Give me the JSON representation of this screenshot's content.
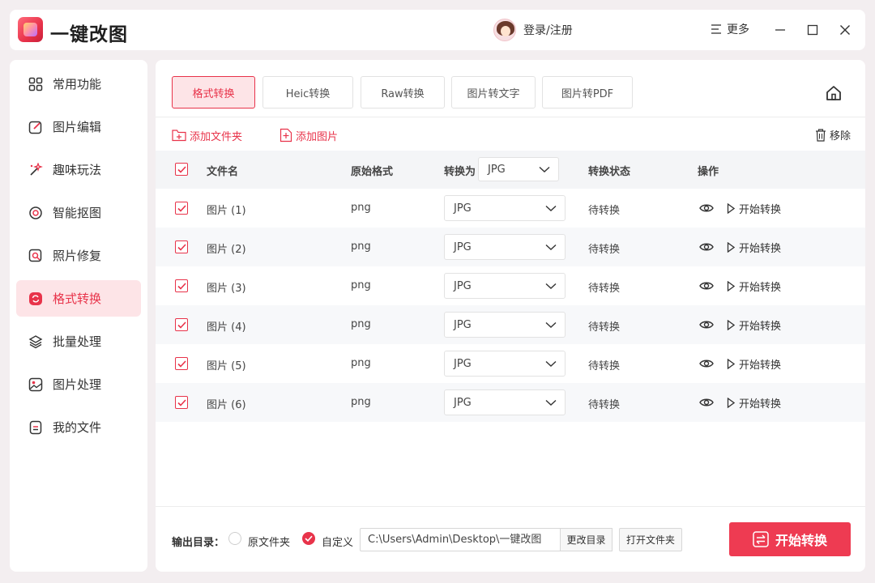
{
  "app": {
    "title": "一键改图",
    "login_label": "登录/注册",
    "more_label": "更多"
  },
  "colors": {
    "accent": "#e8334a",
    "accent_light": "#fde4e7",
    "background": "#f3eef0"
  },
  "sidebar": {
    "items": [
      {
        "label": "常用功能",
        "icon": "grid-icon"
      },
      {
        "label": "图片编辑",
        "icon": "edit-icon"
      },
      {
        "label": "趣味玩法",
        "icon": "magic-wand-icon"
      },
      {
        "label": "智能抠图",
        "icon": "target-icon"
      },
      {
        "label": "照片修复",
        "icon": "repair-icon"
      },
      {
        "label": "格式转换",
        "icon": "convert-icon",
        "active": true
      },
      {
        "label": "批量处理",
        "icon": "layers-icon"
      },
      {
        "label": "图片处理",
        "icon": "image-icon"
      },
      {
        "label": "我的文件",
        "icon": "file-icon"
      }
    ]
  },
  "tabs": [
    {
      "label": "格式转换",
      "active": true
    },
    {
      "label": "Heic转换"
    },
    {
      "label": "Raw转换"
    },
    {
      "label": "图片转文字"
    },
    {
      "label": "图片转PDF"
    }
  ],
  "toolbar": {
    "add_folder": "添加文件夹",
    "add_image": "添加图片",
    "remove": "移除"
  },
  "table": {
    "headers": {
      "filename": "文件名",
      "original_format": "原始格式",
      "convert_to": "转换为",
      "convert_to_value": "JPG",
      "status": "转换状态",
      "actions": "操作"
    },
    "rows": [
      {
        "name": "图片 (1)",
        "format": "png",
        "target": "JPG",
        "status": "待转换",
        "action": "开始转换",
        "checked": true
      },
      {
        "name": "图片 (2)",
        "format": "png",
        "target": "JPG",
        "status": "待转换",
        "action": "开始转换",
        "checked": true
      },
      {
        "name": "图片 (3)",
        "format": "png",
        "target": "JPG",
        "status": "待转换",
        "action": "开始转换",
        "checked": true
      },
      {
        "name": "图片 (4)",
        "format": "png",
        "target": "JPG",
        "status": "待转换",
        "action": "开始转换",
        "checked": true
      },
      {
        "name": "图片 (5)",
        "format": "png",
        "target": "JPG",
        "status": "待转换",
        "action": "开始转换",
        "checked": true
      },
      {
        "name": "图片 (6)",
        "format": "png",
        "target": "JPG",
        "status": "待转换",
        "action": "开始转换",
        "checked": true
      }
    ]
  },
  "footer": {
    "output_label": "输出目录：",
    "option_original": "原文件夹",
    "option_custom": "自定义",
    "path_value": "C:\\Users\\Admin\\Desktop\\一键改图",
    "change_dir": "更改目录",
    "open_folder": "打开文件夹",
    "start_button": "开始转换"
  }
}
